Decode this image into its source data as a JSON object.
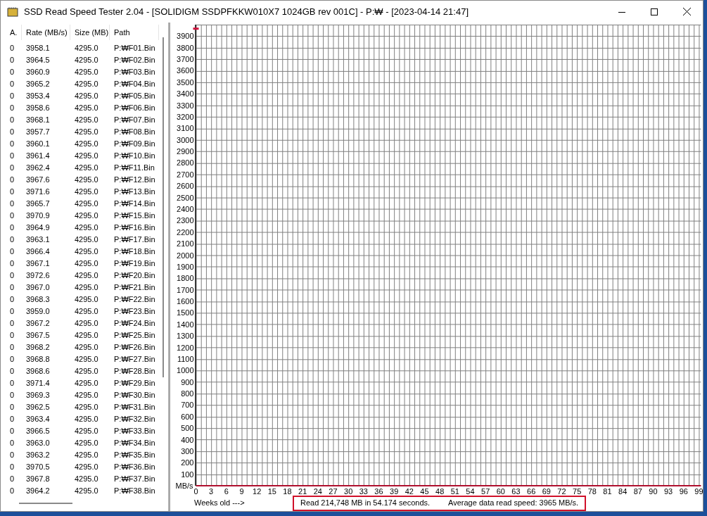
{
  "window": {
    "title": "SSD Read Speed Tester 2.04 - [SOLIDIGM SSDPFKKW010X7 1024GB rev 001C] - P:₩ - [2023-04-14 21:47]"
  },
  "table": {
    "columns": [
      "A.",
      "Rate (MB/s)",
      "Size (MB)",
      "Path"
    ],
    "rows": [
      [
        "0",
        "3958.1",
        "4295.0",
        "P:₩F01.Bin"
      ],
      [
        "0",
        "3964.5",
        "4295.0",
        "P:₩F02.Bin"
      ],
      [
        "0",
        "3960.9",
        "4295.0",
        "P:₩F03.Bin"
      ],
      [
        "0",
        "3965.2",
        "4295.0",
        "P:₩F04.Bin"
      ],
      [
        "0",
        "3953.4",
        "4295.0",
        "P:₩F05.Bin"
      ],
      [
        "0",
        "3958.6",
        "4295.0",
        "P:₩F06.Bin"
      ],
      [
        "0",
        "3968.1",
        "4295.0",
        "P:₩F07.Bin"
      ],
      [
        "0",
        "3957.7",
        "4295.0",
        "P:₩F08.Bin"
      ],
      [
        "0",
        "3960.1",
        "4295.0",
        "P:₩F09.Bin"
      ],
      [
        "0",
        "3961.4",
        "4295.0",
        "P:₩F10.Bin"
      ],
      [
        "0",
        "3962.4",
        "4295.0",
        "P:₩F11.Bin"
      ],
      [
        "0",
        "3967.6",
        "4295.0",
        "P:₩F12.Bin"
      ],
      [
        "0",
        "3971.6",
        "4295.0",
        "P:₩F13.Bin"
      ],
      [
        "0",
        "3965.7",
        "4295.0",
        "P:₩F14.Bin"
      ],
      [
        "0",
        "3970.9",
        "4295.0",
        "P:₩F15.Bin"
      ],
      [
        "0",
        "3964.9",
        "4295.0",
        "P:₩F16.Bin"
      ],
      [
        "0",
        "3963.1",
        "4295.0",
        "P:₩F17.Bin"
      ],
      [
        "0",
        "3966.4",
        "4295.0",
        "P:₩F18.Bin"
      ],
      [
        "0",
        "3967.1",
        "4295.0",
        "P:₩F19.Bin"
      ],
      [
        "0",
        "3972.6",
        "4295.0",
        "P:₩F20.Bin"
      ],
      [
        "0",
        "3967.0",
        "4295.0",
        "P:₩F21.Bin"
      ],
      [
        "0",
        "3968.3",
        "4295.0",
        "P:₩F22.Bin"
      ],
      [
        "0",
        "3959.0",
        "4295.0",
        "P:₩F23.Bin"
      ],
      [
        "0",
        "3967.2",
        "4295.0",
        "P:₩F24.Bin"
      ],
      [
        "0",
        "3967.5",
        "4295.0",
        "P:₩F25.Bin"
      ],
      [
        "0",
        "3968.2",
        "4295.0",
        "P:₩F26.Bin"
      ],
      [
        "0",
        "3968.8",
        "4295.0",
        "P:₩F27.Bin"
      ],
      [
        "0",
        "3968.6",
        "4295.0",
        "P:₩F28.Bin"
      ],
      [
        "0",
        "3971.4",
        "4295.0",
        "P:₩F29.Bin"
      ],
      [
        "0",
        "3969.3",
        "4295.0",
        "P:₩F30.Bin"
      ],
      [
        "0",
        "3962.5",
        "4295.0",
        "P:₩F31.Bin"
      ],
      [
        "0",
        "3963.4",
        "4295.0",
        "P:₩F32.Bin"
      ],
      [
        "0",
        "3966.5",
        "4295.0",
        "P:₩F33.Bin"
      ],
      [
        "0",
        "3963.0",
        "4295.0",
        "P:₩F34.Bin"
      ],
      [
        "0",
        "3963.2",
        "4295.0",
        "P:₩F35.Bin"
      ],
      [
        "0",
        "3970.5",
        "4295.0",
        "P:₩F36.Bin"
      ],
      [
        "0",
        "3967.8",
        "4295.0",
        "P:₩F37.Bin"
      ],
      [
        "0",
        "3964.2",
        "4295.0",
        "P:₩F38.Bin"
      ]
    ]
  },
  "chart": {
    "chart_data": {
      "type": "scatter",
      "ylabel": "MB/s",
      "xlabel": "Weeks old --->",
      "grid": true,
      "x": [
        0
      ],
      "series": [
        {
          "color": "#d0103a",
          "values": [
            3965
          ]
        }
      ],
      "xlim": [
        0,
        99
      ],
      "ylim": [
        0,
        4000
      ],
      "xticks": [
        0,
        3,
        6,
        9,
        12,
        15,
        18,
        21,
        24,
        27,
        30,
        33,
        36,
        39,
        42,
        45,
        48,
        51,
        54,
        57,
        60,
        63,
        66,
        69,
        72,
        75,
        78,
        81,
        84,
        87,
        90,
        93,
        96,
        99
      ],
      "yticks": [
        100,
        200,
        300,
        400,
        500,
        600,
        700,
        800,
        900,
        1000,
        1100,
        1200,
        1300,
        1400,
        1500,
        1600,
        1700,
        1800,
        1900,
        2000,
        2100,
        2200,
        2300,
        2400,
        2500,
        2600,
        2700,
        2800,
        2900,
        3000,
        3100,
        3200,
        3300,
        3400,
        3500,
        3600,
        3700,
        3800,
        3900
      ]
    }
  },
  "status": {
    "read": "Read 214,748 MB in 54.174 seconds.",
    "average": "Average data read speed: 3965 MB/s."
  }
}
